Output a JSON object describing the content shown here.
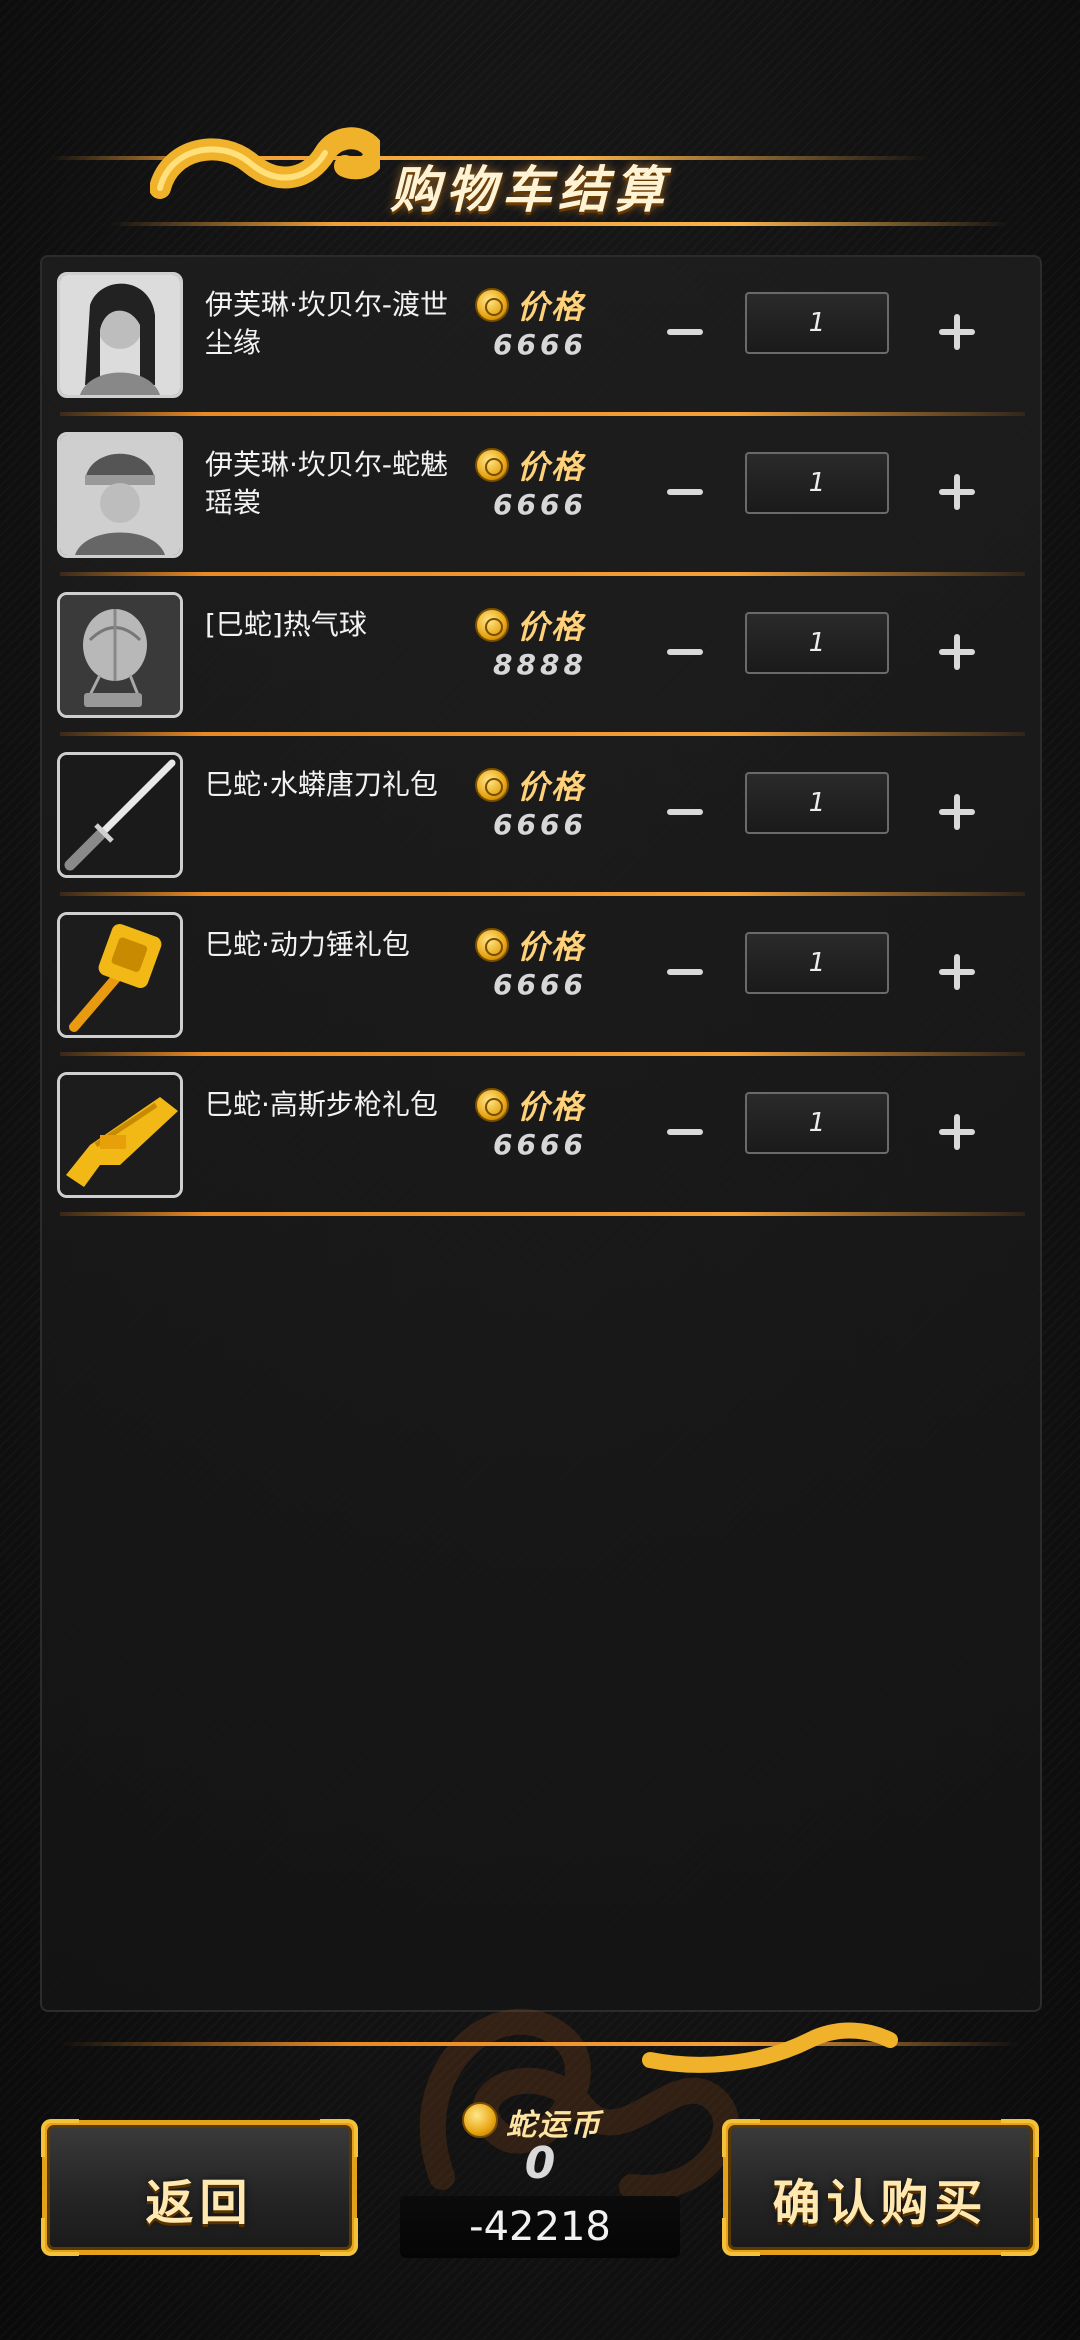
{
  "header": {
    "title": "购物车结算"
  },
  "price_label": "价格",
  "items": [
    {
      "name": "伊芙琳·坎贝尔-渡世尘缘",
      "price": "6666",
      "quantity": "1",
      "thumb": "portrait-woman-icon"
    },
    {
      "name": "伊芙琳·坎贝尔-蛇魅瑶裳",
      "price": "6666",
      "quantity": "1",
      "thumb": "portrait-headdress-icon"
    },
    {
      "name": "[巳蛇]热气球",
      "price": "8888",
      "quantity": "1",
      "thumb": "hot-air-balloon-icon"
    },
    {
      "name": "巳蛇·水蟒唐刀礼包",
      "price": "6666",
      "quantity": "1",
      "thumb": "katana-icon"
    },
    {
      "name": "巳蛇·动力锤礼包",
      "price": "6666",
      "quantity": "1",
      "thumb": "golden-hammer-icon"
    },
    {
      "name": "巳蛇·高斯步枪礼包",
      "price": "6666",
      "quantity": "1",
      "thumb": "golden-rifle-icon"
    }
  ],
  "footer": {
    "back_label": "返回",
    "confirm_label": "确认购买",
    "currency_label": "蛇运币",
    "currency_value": "0",
    "balance": "-42218"
  },
  "colors": {
    "accent": "#f4a03a",
    "gold": "#e8a614",
    "panel": "#161616"
  }
}
